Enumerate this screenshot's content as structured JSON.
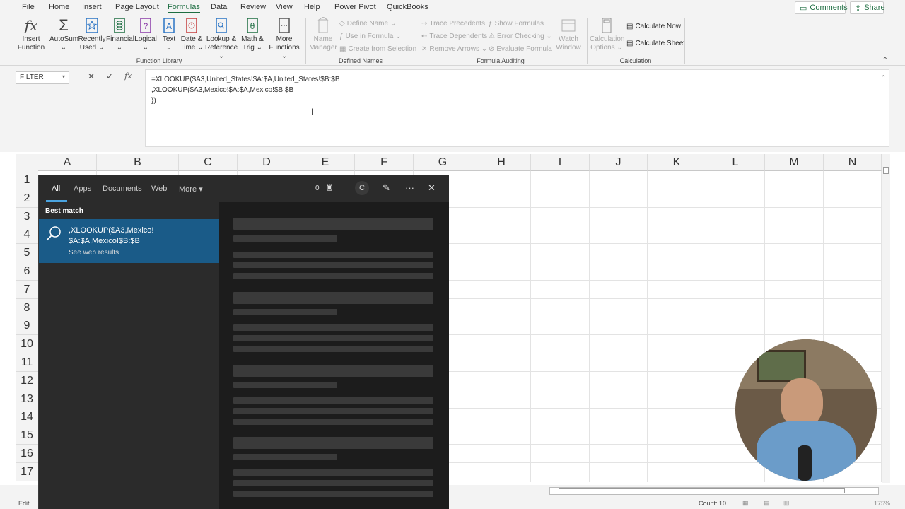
{
  "menu": {
    "items": [
      "File",
      "Home",
      "Insert",
      "Page Layout",
      "Formulas",
      "Data",
      "Review",
      "View",
      "Help",
      "Power Pivot",
      "QuickBooks"
    ],
    "active": "Formulas"
  },
  "top_buttons": {
    "comments": "Comments",
    "share": "Share"
  },
  "ribbon": {
    "insert_function": {
      "line1": "Insert",
      "line2": "Function"
    },
    "autosum": {
      "line1": "AutoSum",
      "line2": "⌄"
    },
    "recently_used": {
      "line1": "Recently",
      "line2": "Used ⌄"
    },
    "financial": {
      "line1": "Financial",
      "line2": "⌄"
    },
    "logical": {
      "line1": "Logical",
      "line2": "⌄"
    },
    "text": {
      "line1": "Text",
      "line2": "⌄"
    },
    "date_time": {
      "line1": "Date &",
      "line2": "Time ⌄"
    },
    "lookup": {
      "line1": "Lookup &",
      "line2": "Reference ⌄"
    },
    "math": {
      "line1": "Math &",
      "line2": "Trig ⌄"
    },
    "more_functions": {
      "line1": "More",
      "line2": "Functions ⌄"
    },
    "function_library_label": "Function Library",
    "name_manager": {
      "line1": "Name",
      "line2": "Manager"
    },
    "define_name": "Define Name ⌄",
    "use_in_formula": "Use in Formula ⌄",
    "create_from_selection": "Create from Selection",
    "defined_names_label": "Defined Names",
    "trace_precedents": "Trace Precedents",
    "trace_dependents": "Trace Dependents",
    "remove_arrows": "Remove Arrows ⌄",
    "show_formulas": "Show Formulas",
    "error_checking": "Error Checking ⌄",
    "evaluate_formula": "Evaluate Formula",
    "watch_window": {
      "line1": "Watch",
      "line2": "Window"
    },
    "formula_auditing_label": "Formula Auditing",
    "calc_options": {
      "line1": "Calculation",
      "line2": "Options ⌄"
    },
    "calculate_now": "Calculate Now",
    "calculate_sheet": "Calculate Sheet",
    "calculation_label": "Calculation"
  },
  "formula_bar": {
    "name_box": "FILTER",
    "fx": "fx",
    "lines": [
      "=XLOOKUP($A3,United_States!$A:$A,United_States!$B:$B",
      ",XLOOKUP($A3,Mexico!$A:$A,Mexico!$B:$B",
      "",
      "})"
    ]
  },
  "columns": [
    "A",
    "B",
    "C",
    "D",
    "E",
    "F",
    "G",
    "H",
    "I",
    "J",
    "K",
    "L",
    "M",
    "N"
  ],
  "rows": [
    "1",
    "2",
    "3",
    "4",
    "5",
    "6",
    "7",
    "8",
    "9",
    "10",
    "11",
    "12",
    "13",
    "14",
    "15",
    "16",
    "17"
  ],
  "search": {
    "tabs": [
      "All",
      "Apps",
      "Documents",
      "Web",
      "More ▾"
    ],
    "points": "0",
    "avatar_letter": "C",
    "best_match_label": "Best match",
    "best_match_title": ",XLOOKUP($A3,Mexico! $A:$A,Mexico!$B:$B",
    "best_match_sub": "See web results"
  },
  "status": {
    "mode": "Edit",
    "count": "Count: 10",
    "zoom": "175%"
  },
  "colors": {
    "excel_green": "#1e6e42",
    "search_highlight": "#1a5b88",
    "search_bg": "#1f1f1f"
  }
}
